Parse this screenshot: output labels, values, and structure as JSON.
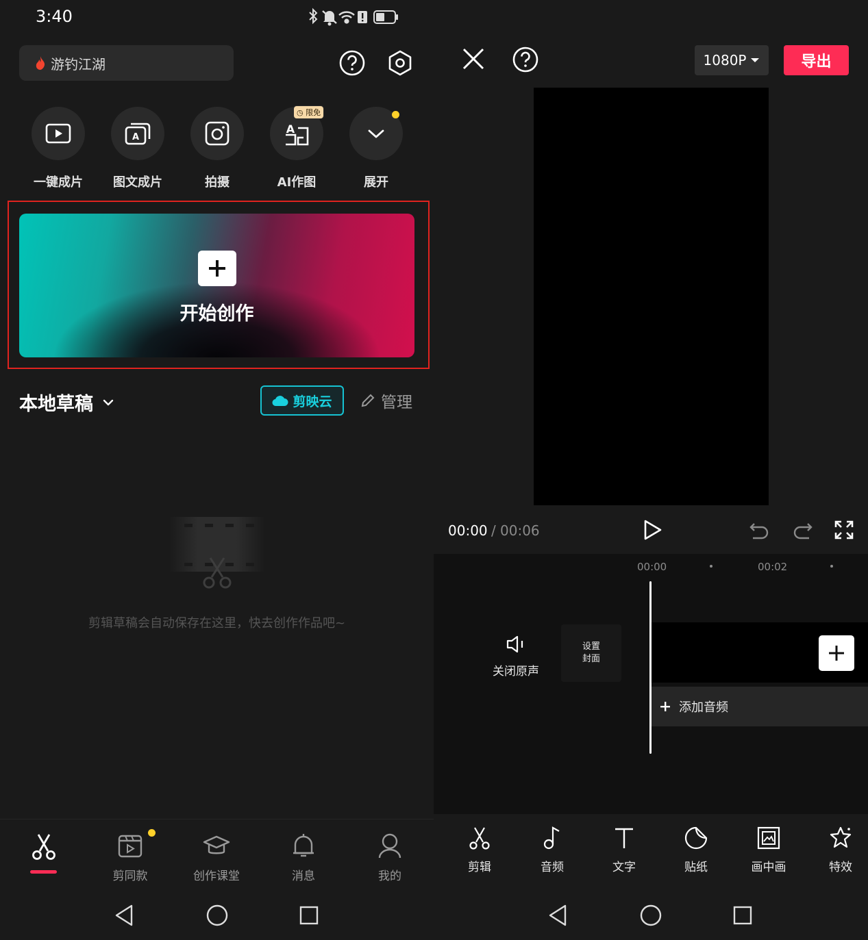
{
  "status_bar": {
    "time": "3:40"
  },
  "home": {
    "search": {
      "placeholder": "游钓江湖"
    },
    "quick_actions": [
      {
        "label": "一键成片",
        "icon": "play-square-icon"
      },
      {
        "label": "图文成片",
        "icon": "text-to-video-icon"
      },
      {
        "label": "拍摄",
        "icon": "camera-icon"
      },
      {
        "label": "AI作图",
        "icon": "ai-image-icon",
        "badge": "限免"
      },
      {
        "label": "展开",
        "icon": "chevron-down-icon"
      }
    ],
    "create_card": {
      "label": "开始创作"
    },
    "drafts": {
      "title": "本地草稿",
      "cloud_button": "剪映云",
      "manage_button": "管理",
      "empty_text": "剪辑草稿会自动保存在这里，快去创作作品吧~"
    },
    "bottom_nav": [
      {
        "label": "",
        "icon": "scissors-icon",
        "active": true
      },
      {
        "label": "剪同款",
        "icon": "template-icon",
        "dot": true
      },
      {
        "label": "创作课堂",
        "icon": "graduation-cap-icon"
      },
      {
        "label": "消息",
        "icon": "bell-icon"
      },
      {
        "label": "我的",
        "icon": "user-icon"
      }
    ],
    "accent_color": "#fe2c55",
    "cloud_color": "#19d0de"
  },
  "editor": {
    "resolution": "1080P",
    "export_label": "导出",
    "current_time": "00:00",
    "separator": "/",
    "total_time": "00:06",
    "ruler": [
      "00:00",
      "00:02"
    ],
    "mute_label": "关闭原声",
    "cover_label_line1": "设置",
    "cover_label_line2": "封面",
    "add_audio_label": "添加音频",
    "toolbar": [
      {
        "label": "剪辑",
        "icon": "scissors-icon"
      },
      {
        "label": "音频",
        "icon": "music-note-icon"
      },
      {
        "label": "文字",
        "icon": "text-icon"
      },
      {
        "label": "贴纸",
        "icon": "sticker-icon"
      },
      {
        "label": "画中画",
        "icon": "picture-in-picture-icon"
      },
      {
        "label": "特效",
        "icon": "star-effect-icon"
      }
    ]
  }
}
